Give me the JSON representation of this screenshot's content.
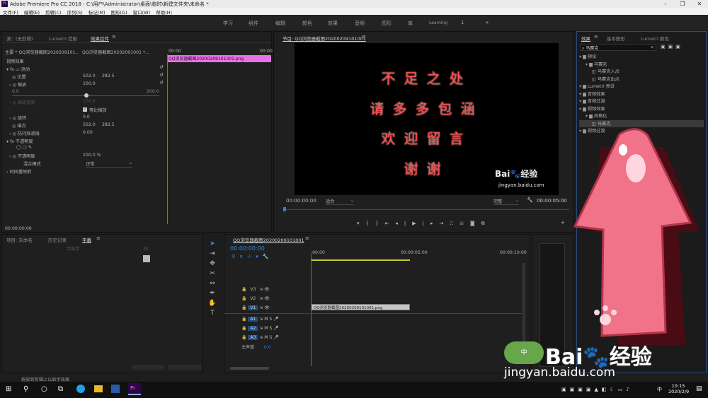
{
  "app": {
    "title": "Adobe Premiere Pro CC 2018 - C:\\用户\\Administrator\\桌面\\临时\\新建文件夹\\未命名 *",
    "logo": "Pr"
  },
  "menu": [
    "文件(F)",
    "编辑(E)",
    "剪辑(C)",
    "序列(S)",
    "标记(M)",
    "图形(G)",
    "窗口(W)",
    "帮助(H)"
  ],
  "workspaces": [
    "学习",
    "组件",
    "编辑",
    "颜色",
    "效果",
    "音频",
    "图形",
    "库",
    "Learning"
  ],
  "ws_counter": "1",
  "ws_more": "»",
  "source_panel": {
    "tabs": [
      "源：(无剪辑)",
      "Lumetri 范围",
      "效果控件"
    ],
    "clip_header": "主要 * QQ浏览器截图2020209101...",
    "seq_header": "QQ浏览器截图20202091001 *...",
    "time_start": "00:00",
    "time_end": "00:00",
    "clip_bar": "QQ浏览器截图20200209101001.png",
    "section_video": "视频效果",
    "motion": "运动",
    "position": "位置",
    "pos_x": "502.0",
    "pos_y": "282.5",
    "scale": "缩放",
    "scale_val": "100.0",
    "slider_min": "0.0",
    "slider_max": "200.0",
    "scale_width": "缩放宽度",
    "scale_width_val": "100.0",
    "uniform_scale": "等比缩放",
    "rotation": "旋转",
    "rotation_val": "0.0",
    "anchor": "锚点",
    "anchor_x": "502.0",
    "anchor_y": "282.5",
    "antiflicker": "防闪烁滤镜",
    "antiflicker_val": "0.00",
    "opacity_group": "不透明度",
    "opacity": "不透明度",
    "opacity_val": "100.0 %",
    "blend": "混合模式",
    "blend_val": "正常",
    "time_remap": "时间重映射",
    "timecode": "00:00:00:00"
  },
  "program_panel": {
    "title": "节目: QQ浏览器截图20200209101001",
    "lines": [
      "不足之处",
      "请多多包涵",
      "欢迎留言",
      "谢谢"
    ],
    "watermark_small": "Bai🐾经验",
    "watermark_url": "jingyan.baidu.com",
    "timecode": "00:00:00:00",
    "fit": "适合",
    "quality": "完整",
    "end_time": "00:00:05:00"
  },
  "project_panel": {
    "tabs": [
      "项目: 未命名",
      "历史记录",
      "字幕"
    ],
    "frame_label": "帧",
    "font_size": "字幕字"
  },
  "timeline": {
    "title": "QQ浏览器截图20200209101001",
    "timecode": "00:00:00:00",
    "ruler": [
      ":00:00",
      "00:00:05:00",
      "00:00:10:00"
    ],
    "tracks_video": [
      "V3",
      "V2",
      "V1"
    ],
    "tracks_audio": [
      "A1",
      "A2",
      "A3"
    ],
    "master": "主声道",
    "master_val": "0.0",
    "clip": "QQ浏览器截图20200209101001.png"
  },
  "effects_panel": {
    "tabs": [
      "效果",
      "基本图形",
      "Lumetri 颜色"
    ],
    "search": "马赛克",
    "tree": [
      {
        "label": "预设",
        "level": 0,
        "folder": true
      },
      {
        "label": "马赛克",
        "level": 1,
        "folder": true
      },
      {
        "label": "马赛克入点",
        "level": 2,
        "folder": false
      },
      {
        "label": "马赛克出点",
        "level": 2,
        "folder": false
      },
      {
        "label": "Lumetri 预设",
        "level": 0,
        "folder": true
      },
      {
        "label": "音频效果",
        "level": 0,
        "folder": true
      },
      {
        "label": "音频过渡",
        "level": 0,
        "folder": true
      },
      {
        "label": "视频效果",
        "level": 0,
        "folder": true
      },
      {
        "label": "风格化",
        "level": 1,
        "folder": true
      },
      {
        "label": "马赛克",
        "level": 2,
        "folder": false,
        "selected": true
      },
      {
        "label": "视频过渡",
        "level": 0,
        "folder": true
      }
    ]
  },
  "status": "拖放到剪辑上以显示效果",
  "taskbar": {
    "time": "10:15",
    "date": "2020/2/9",
    "ime": "中"
  },
  "overlay": {
    "logo": "Bai🐾经验",
    "url": "jingyan.baidu.com",
    "badge": "中"
  }
}
